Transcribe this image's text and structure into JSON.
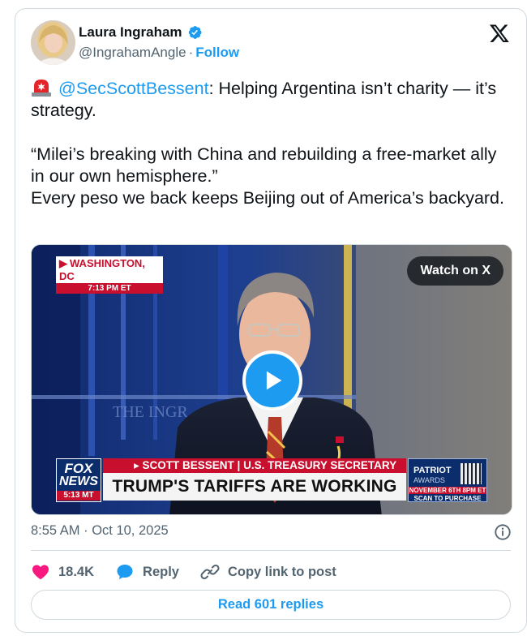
{
  "author": {
    "display_name": "Laura Ingraham",
    "handle": "@IngrahamAngle",
    "separator": "·",
    "follow_label": "Follow",
    "verified": true
  },
  "tweet": {
    "siren_icon": "rotating-light-icon",
    "mention": "@SecScottBessent",
    "line1_rest": ": Helping Argentina isn’t charity — it’s strategy.",
    "quote": "“Milei’s breaking with China and rebuilding a free-market ally in our own hemisphere.”",
    "line3": "Every peso we back keeps Beijing out of America’s backyard."
  },
  "media": {
    "watch_label": "Watch on X",
    "location": "WASHINGTON, DC",
    "location_time": "7:13 PM ET",
    "backdrop_text": "THE INGR",
    "lower_third_name": "SCOTT BESSENT | U.S. TREASURY SECRETARY",
    "lower_third_headline": "TRUMP'S TARIFFS ARE WORKING",
    "fox_line1": "FOX",
    "fox_line2": "NEWS",
    "fox_time": "5:13 MT",
    "promo_line1": "PATRIOT",
    "promo_line2": "AWARDS",
    "promo_date": "NOVEMBER 6TH 8PM ET",
    "promo_cta": "SCAN TO PURCHASE"
  },
  "footer": {
    "timestamp": "8:55 AM · Oct 10, 2025",
    "like_count": "18.4K",
    "reply_label": "Reply",
    "copy_label": "Copy link to post",
    "read_replies_label": "Read 601 replies"
  },
  "colors": {
    "accent": "#1d9bf0",
    "like": "#f91880",
    "text": "#0f1419",
    "muted": "#536471",
    "border": "#cfd9de"
  }
}
